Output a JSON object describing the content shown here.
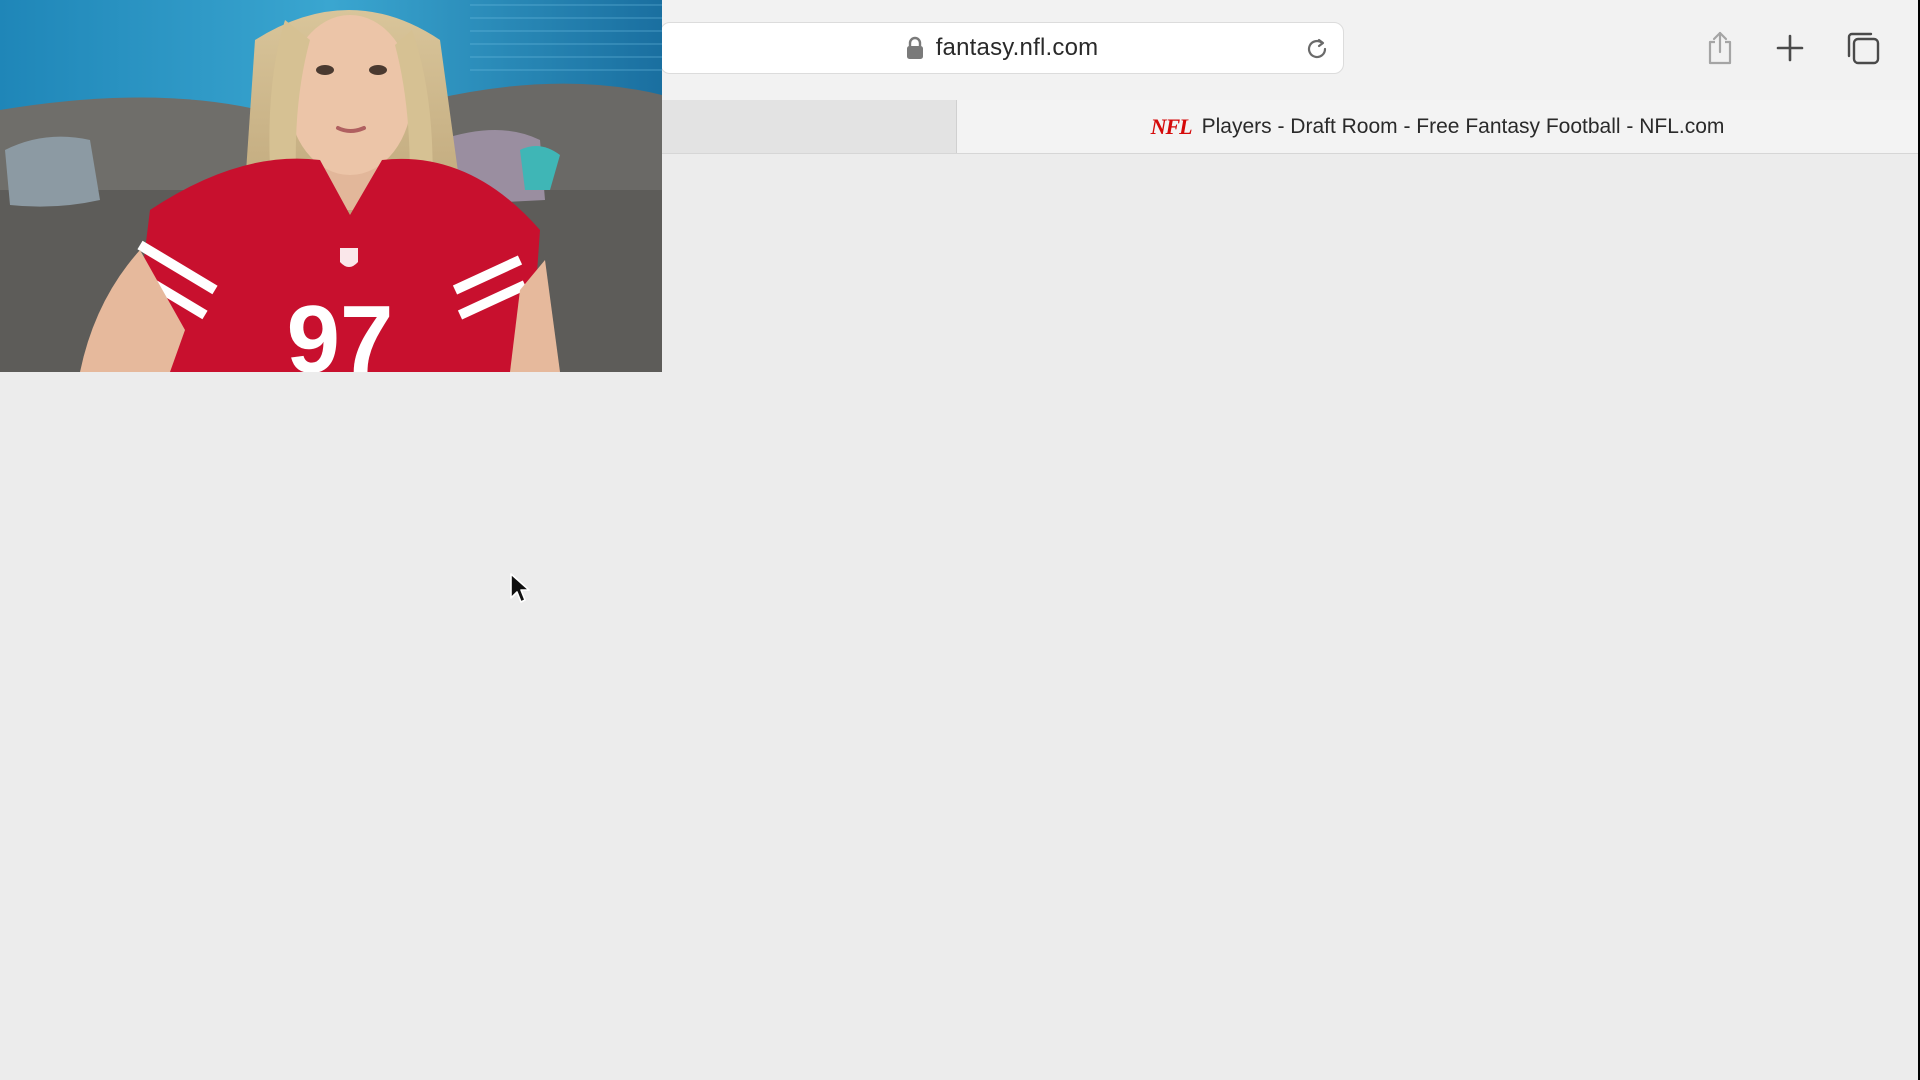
{
  "browser": {
    "address_bar": {
      "url": "fantasy.nfl.com"
    },
    "tabs": [
      {
        "label": "",
        "active": false
      },
      {
        "label": "Players - Draft Room - Free Fantasy Football - NFL.com",
        "active": true,
        "favicon_text": "NFL"
      }
    ],
    "toolbar_icons": [
      "share-icon",
      "plus-icon",
      "tabs-overview-icon"
    ]
  },
  "webcam": {
    "jersey_number": "97"
  },
  "colors": {
    "nfl_red": "#d50a0a",
    "jersey_red": "#c8102e",
    "page_background": "#ececec"
  }
}
